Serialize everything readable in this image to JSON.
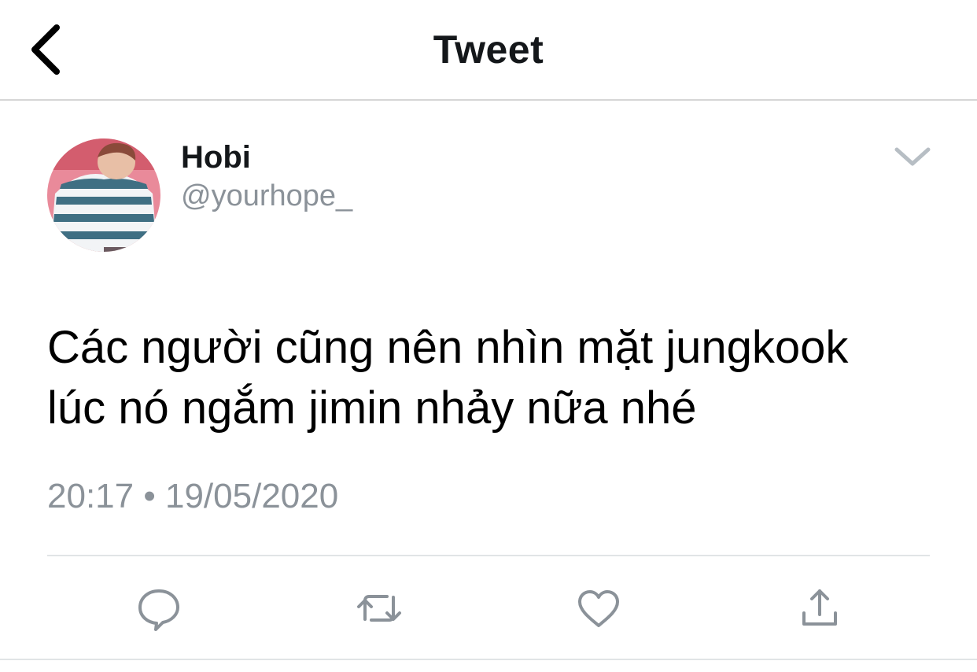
{
  "header": {
    "title": "Tweet",
    "back_icon": "chevron-left-icon"
  },
  "tweet": {
    "display_name": "Hobi",
    "handle": "@yourhope_",
    "text_line1": "Các người cũng nên nhìn mặt jungkook",
    "text_line2": "lúc nó ngắm jimin nhảy nữa nhé",
    "time": "20:17",
    "separator": "•",
    "date": "19/05/2020",
    "menu_icon": "chevron-down-icon"
  },
  "actions": [
    {
      "icon": "reply-icon"
    },
    {
      "icon": "retweet-icon"
    },
    {
      "icon": "like-icon"
    },
    {
      "icon": "share-icon"
    }
  ],
  "colors": {
    "text": "#14171a",
    "secondary": "#8b9299",
    "icon": "#8b9299",
    "divider": "#e1e4e6"
  }
}
